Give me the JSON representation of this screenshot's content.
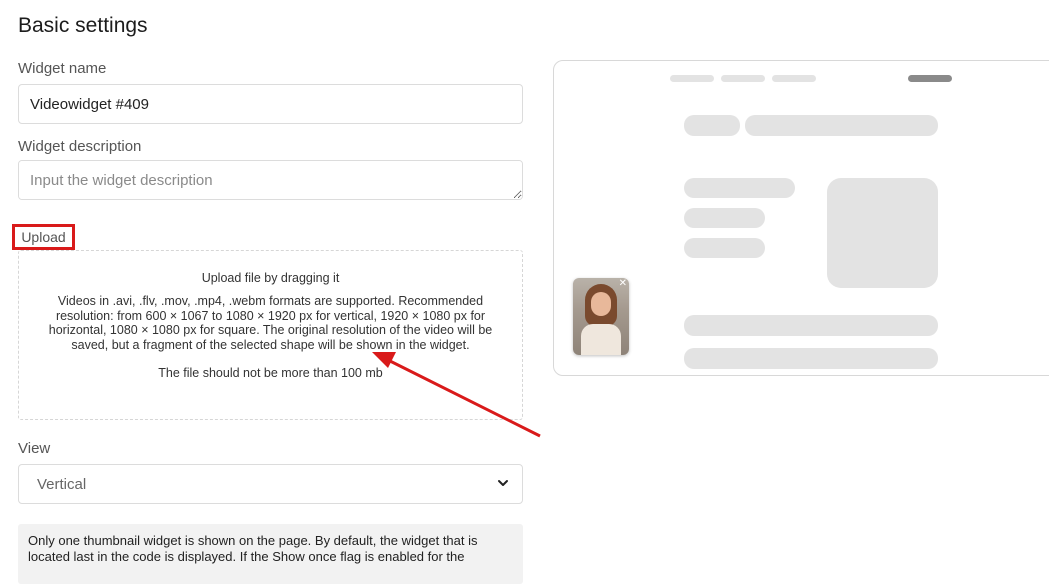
{
  "page": {
    "title": "Basic settings"
  },
  "widget_name": {
    "label": "Widget name",
    "value": "Videowidget #409"
  },
  "widget_description": {
    "label": "Widget description",
    "placeholder": "Input the widget description"
  },
  "upload": {
    "label": "Upload",
    "title": "Upload file by dragging it",
    "description": "Videos in .avi, .flv, .mov, .mp4, .webm formats are supported. Recommended resolution: from 600 × 1067 to 1080 × 1920 px for vertical, 1920 × 1080 px for horizontal, 1080 × 1080 px for square. The original resolution of the video will be saved, but a fragment of the selected shape will be shown in the widget.",
    "limit": "The file should not be more than 100 mb"
  },
  "view": {
    "label": "View",
    "selected": "Vertical"
  },
  "note": {
    "text": "Only one thumbnail widget is shown on the page. By default, the widget that is located last in the code is displayed. If the Show once flag is enabled for the"
  },
  "colors": {
    "highlight": "#d91a1a",
    "skeleton": "#e3e3e3",
    "note_bg": "#f2f2f2"
  },
  "icons": {
    "select": "chevron-down-icon",
    "thumb_close": "close-icon"
  }
}
